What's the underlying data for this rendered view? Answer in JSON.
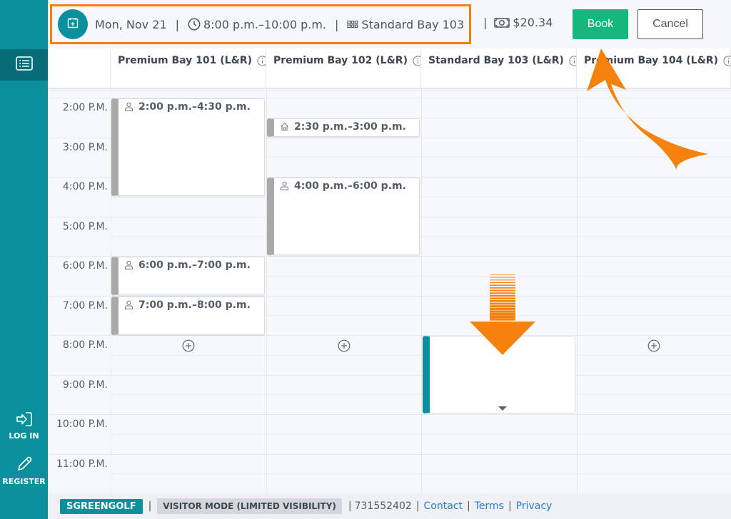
{
  "sidebar": {
    "items": [
      {
        "label": "",
        "icon": "list-icon",
        "active": true
      },
      {
        "label": "LOG IN",
        "icon": "login-icon"
      },
      {
        "label": "REGISTER",
        "icon": "pencil-icon"
      }
    ]
  },
  "header": {
    "date": "Mon, Nov 21",
    "time_range": "8:00 p.m.–10:00 p.m.",
    "bay": "Standard Bay 103 ...",
    "price": "$20.34",
    "separator": "|",
    "book_label": "Book",
    "cancel_label": "Cancel"
  },
  "columns": [
    {
      "label": "Premium Bay 101 (L&R)"
    },
    {
      "label": "Premium Bay 102 (L&R)"
    },
    {
      "label": "Standard Bay 103 (L&R)"
    },
    {
      "label": "Premium Bay 104 (L&R)"
    }
  ],
  "time_labels": [
    "2:00 P.M.",
    "3:00 P.M.",
    "4:00 P.M.",
    "5:00 P.M.",
    "6:00 P.M.",
    "7:00 P.M.",
    "8:00 P.M.",
    "9:00 P.M.",
    "10:00 P.M.",
    "11:00 P.M."
  ],
  "bookings": [
    {
      "column": 0,
      "start": 14.0,
      "end": 16.5,
      "label": "2:00 p.m.–4:30 p.m.",
      "icon": "person-icon"
    },
    {
      "column": 1,
      "start": 14.5,
      "end": 15.0,
      "label": "2:30 p.m.–3:00 p.m.",
      "icon": "home-icon"
    },
    {
      "column": 1,
      "start": 16.0,
      "end": 18.0,
      "label": "4:00 p.m.–6:00 p.m.",
      "icon": "person-icon"
    },
    {
      "column": 0,
      "start": 18.0,
      "end": 19.0,
      "label": "6:00 p.m.–7:00 p.m.",
      "icon": "person-icon"
    },
    {
      "column": 0,
      "start": 19.0,
      "end": 20.0,
      "label": "7:00 p.m.–8:00 p.m.",
      "icon": "person-icon"
    }
  ],
  "selection": {
    "column": 2,
    "start": 20.0,
    "end": 22.0
  },
  "footer": {
    "brand": "SGREENGOLF",
    "mode": "VISITOR MODE (LIMITED VISIBILITY)",
    "account": "731552402",
    "links": [
      "Contact",
      "Terms",
      "Privacy"
    ]
  },
  "colors": {
    "accent": "#0a8f9d",
    "book": "#15b77e",
    "annotation": "#f5820d",
    "booking_bar": "#a9a9a9"
  }
}
